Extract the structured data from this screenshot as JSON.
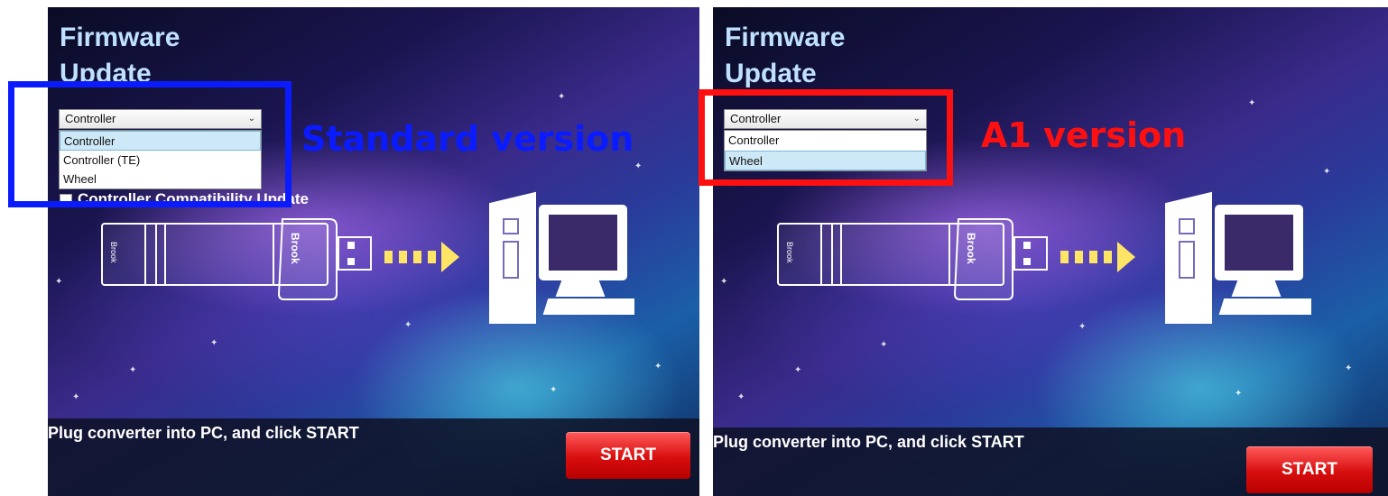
{
  "colors": {
    "standard_highlight": "#0a1cff",
    "a1_highlight": "#ff1010",
    "start_button": "#e01515",
    "title_text": "#bfe0ff"
  },
  "left_panel": {
    "title_line1": "Firmware",
    "title_line2": "Update",
    "select_value": "Controller",
    "dropdown_options": [
      "Controller",
      "Controller (TE)",
      "Wheel"
    ],
    "selected_option": "Controller",
    "checkbox_label": "Controller Compatibility Update",
    "instructions": "Plug converter into PC, and click START",
    "start_label": "START"
  },
  "right_panel": {
    "title_line1": "Firmware",
    "title_line2": "Update",
    "select_value": "Controller",
    "dropdown_options": [
      "Controller",
      "Wheel"
    ],
    "selected_option": "Wheel",
    "instructions": "Plug converter into PC, and click START",
    "start_label": "START"
  },
  "annotations": {
    "standard_label": "Standard version",
    "a1_label": "A1 version"
  },
  "usb_brand": "Brook",
  "icons": [
    "chevron-down-icon",
    "usb-converter-icon",
    "desktop-pc-icon",
    "arrow-right-icon",
    "star-icon"
  ]
}
